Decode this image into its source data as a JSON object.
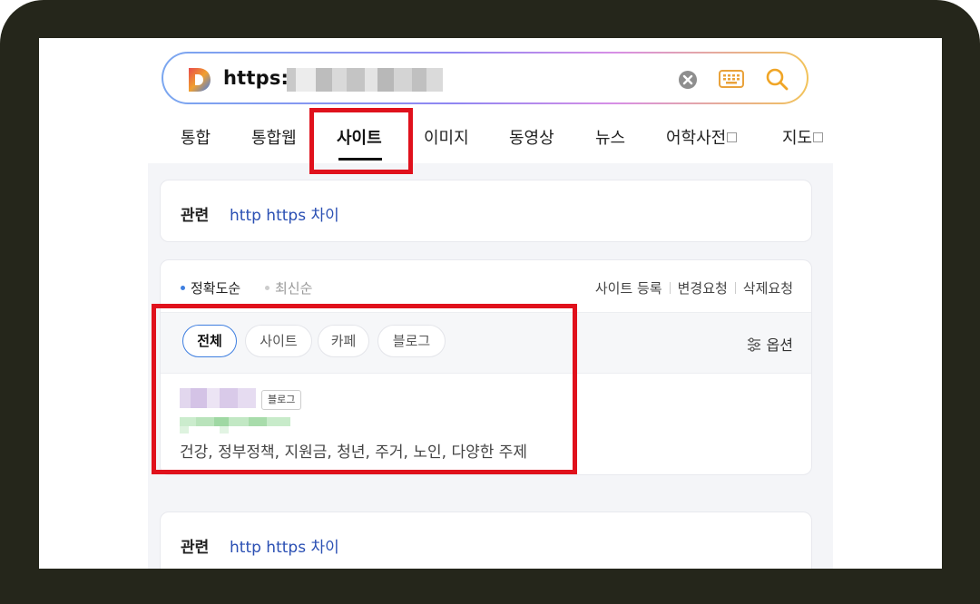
{
  "search": {
    "url_text": "https:/",
    "icons": [
      "daum-logo",
      "clear-icon",
      "keyboard-icon",
      "search-icon"
    ]
  },
  "tabs": [
    {
      "label": "통합"
    },
    {
      "label": "통합웹"
    },
    {
      "label": "사이트"
    },
    {
      "label": "이미지"
    },
    {
      "label": "동영상"
    },
    {
      "label": "뉴스"
    },
    {
      "label": "어학사전"
    },
    {
      "label": "지도"
    }
  ],
  "related_top": {
    "label": "관련",
    "link": "http https 차이"
  },
  "results": {
    "sort": {
      "accuracy": "정확도순",
      "recent": "최신순"
    },
    "links": {
      "register": "사이트 등록",
      "change": "변경요청",
      "delete": "삭제요청"
    },
    "filters": [
      "전체",
      "사이트",
      "카페",
      "블로그"
    ],
    "option_label": "옵션",
    "item": {
      "badge": "블로그",
      "description": "건강, 정부정책, 지원금, 청년, 주거, 노인, 다양한 주제"
    }
  },
  "related_bottom": {
    "label": "관련",
    "link": "http https 차이"
  },
  "colors": {
    "highlight": "#e0111c",
    "link": "#2a4fb3",
    "frame": "#25261b",
    "accent_blue": "#3f7fe0"
  }
}
